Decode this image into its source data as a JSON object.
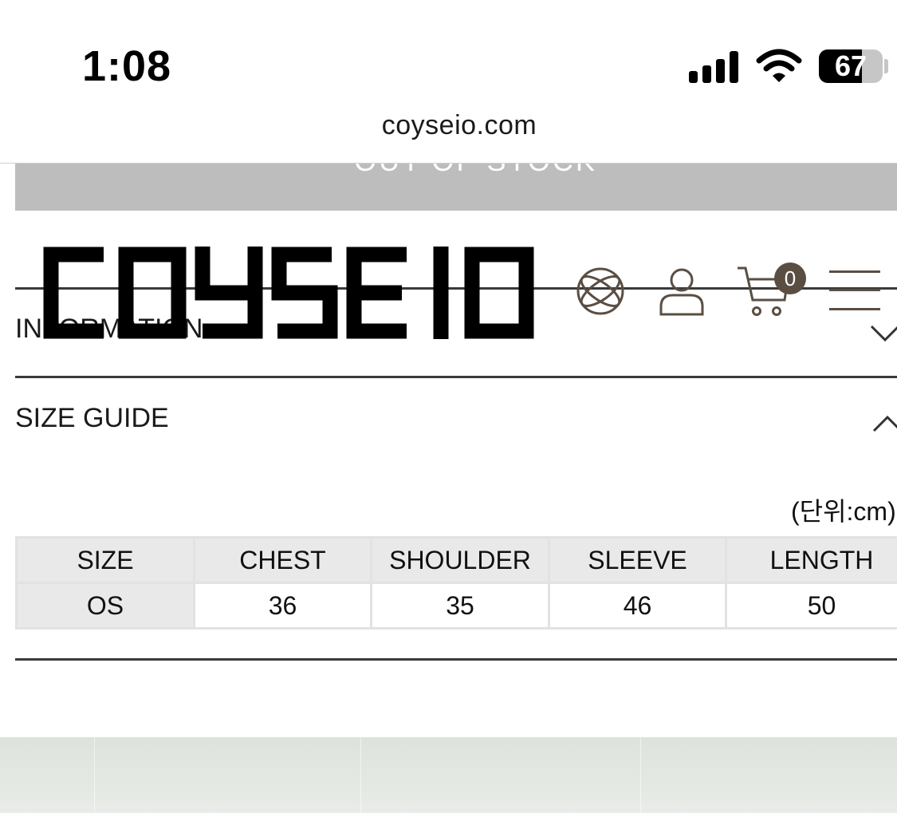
{
  "status_bar": {
    "time": "1:08",
    "battery": 67
  },
  "browser": {
    "url": "coyseio.com"
  },
  "product": {
    "out_of_stock_label": "OUT OF STOCK"
  },
  "header": {
    "brand": "COYSEIO",
    "cart_count": "0",
    "icons": [
      "globe-icon",
      "user-icon",
      "cart-icon",
      "menu-icon"
    ]
  },
  "accordion": [
    {
      "label": "INFORMATION",
      "expanded": false
    },
    {
      "label": "SIZE GUIDE",
      "expanded": true
    }
  ],
  "size_guide": {
    "unit": "(단위:cm)",
    "columns": [
      "SIZE",
      "CHEST",
      "SHOULDER",
      "SLEEVE",
      "LENGTH"
    ],
    "rows": [
      {
        "size": "OS",
        "chest": "36",
        "shoulder": "35",
        "sleeve": "46",
        "length": "50"
      }
    ]
  },
  "colors": {
    "icon_brown": "#5a4e43",
    "table_header_bg": "#e9e9e9",
    "oos_bg": "#bdbdbd"
  }
}
